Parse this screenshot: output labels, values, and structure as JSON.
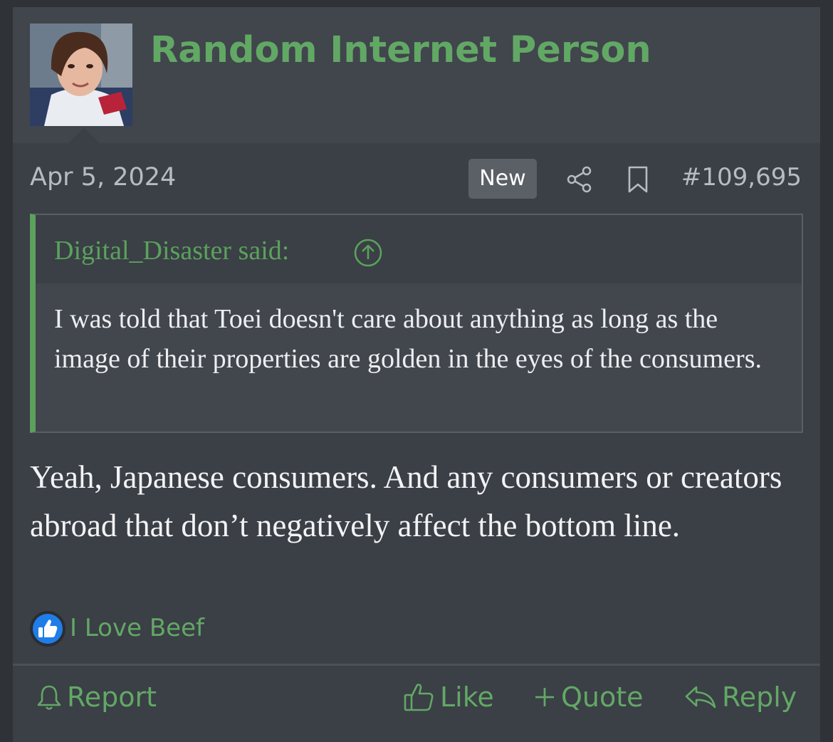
{
  "post": {
    "username": "Random Internet Person",
    "date": "Apr 5, 2024",
    "badge": "New",
    "post_number": "#109,695",
    "quote": {
      "author": "Digital_Disaster said:",
      "text": "I was told that Toei doesn't care about anything as long as the image of their properties are golden in the eyes of the consumers."
    },
    "message": "Yeah, Japanese consumers. And any consumers or creators abroad that don’t negatively affect the bottom line.",
    "reaction": {
      "icon": "thumbs-up-icon",
      "users": "I Love Beef"
    },
    "actions": {
      "report": "Report",
      "like": "Like",
      "quote": "Quote",
      "reply": "Reply"
    }
  },
  "colors": {
    "accent": "#62a865",
    "background": "#3b3f46",
    "header": "#41454c",
    "quote_border": "#5aa25c"
  }
}
